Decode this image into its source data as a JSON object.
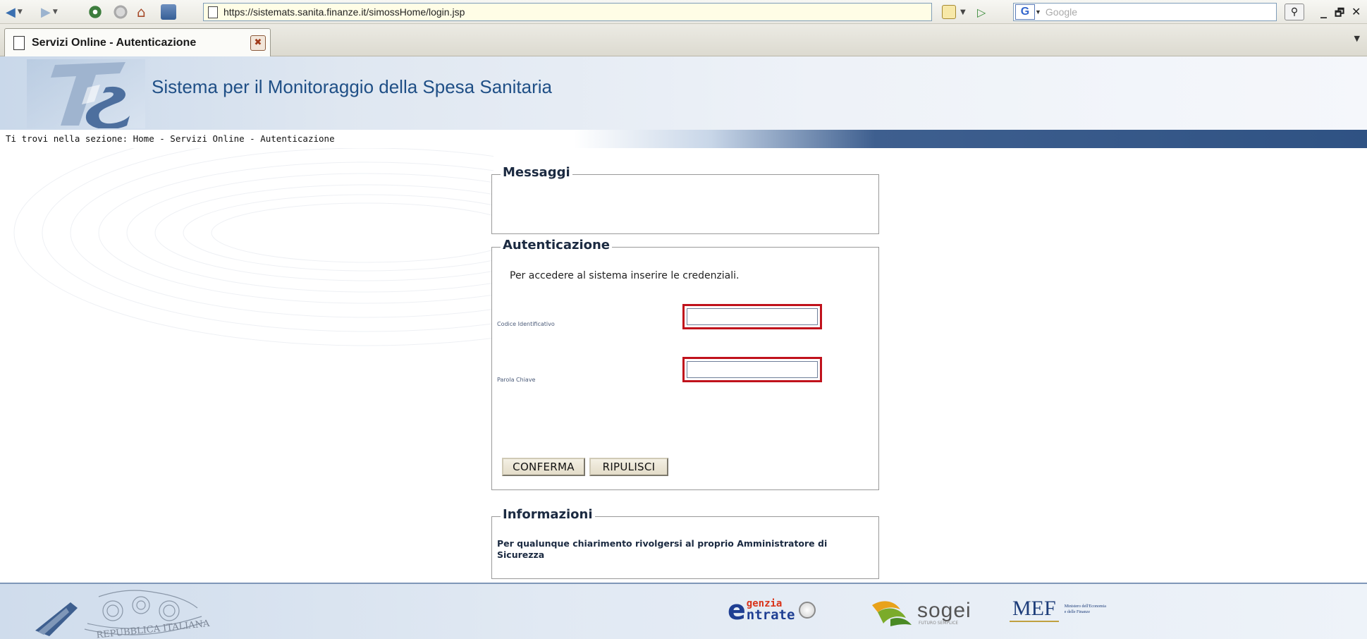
{
  "browser": {
    "url": "https://sistemats.sanita.finanze.it/simossHome/login.jsp",
    "search_placeholder": "Google",
    "search_engine_letter": "G",
    "tab_title": "Servizi Online - Autenticazione",
    "window_minimize": "_",
    "window_restore": "🗗",
    "window_close": "✕"
  },
  "header": {
    "logo_text": "TS",
    "title": "Sistema per il Monitoraggio della Spesa Sanitaria",
    "breadcrumb": "Ti trovi nella sezione: Home - Servizi Online - Autenticazione"
  },
  "messaggi": {
    "legend": "Messaggi"
  },
  "auth": {
    "legend": "Autenticazione",
    "intro": "Per accedere al sistema inserire le credenziali.",
    "codice_label": "Codice Identificativo",
    "codice_value": "",
    "parola_label": "Parola Chiave",
    "parola_value": "",
    "confirm_label": "CONFERMA",
    "reset_label": "RIPULISCI"
  },
  "info": {
    "legend": "Informazioni",
    "text": "Per qualunque chiarimento rivolgersi al proprio Amministratore di Sicurezza"
  },
  "footer": {
    "ae_prefix": "e",
    "ae_line1": "genzia",
    "ae_line2": "ntrate",
    "sogei_name": "sogei",
    "sogei_tagline": "FUTURO SEMPLICE",
    "mef_name": "MEF",
    "mef_desc": "Ministero dell'Economia e delle Finanze",
    "seal_text": "REPUBBLICA ITALIANA"
  },
  "colors": {
    "title_blue": "#1f4f86",
    "breadcrumb_band": "#2f5283",
    "highlight_red": "#c0121c"
  }
}
